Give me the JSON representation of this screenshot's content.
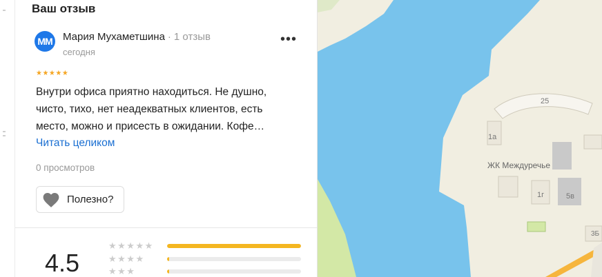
{
  "review_panel": {
    "heading": "Ваш отзыв",
    "review": {
      "avatar_initials": "ММ",
      "author": "Мария Мухаметшина",
      "separator": "·",
      "reviews_count": "1 отзыв",
      "date": "сегодня",
      "more_label": "•••",
      "stars": "★★★★★",
      "text_lines": [
        "Внутри офиса приятно находиться. Не душно,",
        "чисто, тихо, нет неадекватных клиентов, есть",
        "место, можно и присесть в ожидании. Кофе…"
      ],
      "read_more": "Читать целиком",
      "views": "0 просмотров",
      "useful_label": "Полезно?"
    },
    "summary": {
      "rating": "4.5",
      "rows": [
        {
          "stars": "★★★★★",
          "fraction": 1.0
        },
        {
          "stars": "★★★★",
          "fraction": 0.01
        },
        {
          "stars": "★★★",
          "fraction": 0.01
        }
      ]
    }
  },
  "map": {
    "labels": {
      "building_25": "25",
      "building_1a": "1а",
      "complex": "ЖК Междуречье",
      "building_1g": "1г",
      "building_5v": "5в",
      "building_3b": "3Б"
    },
    "colors": {
      "water": "#78c3ec",
      "land": "#f1eee1",
      "green": "#d3e8a6",
      "building": "#e8e4d8",
      "road": "#f6b53c"
    }
  },
  "colors": {
    "link": "#1a6fd2",
    "star": "#f5a623",
    "bar_fill": "#f4b620",
    "avatar": "#1e78e8"
  }
}
